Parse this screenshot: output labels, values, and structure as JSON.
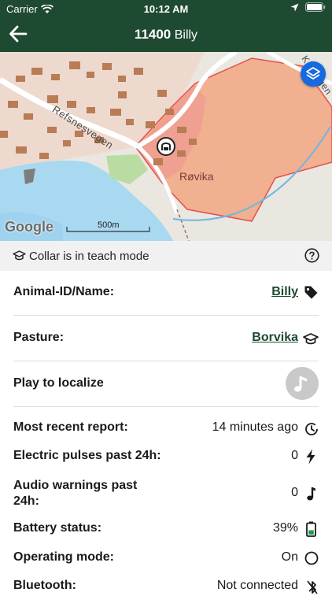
{
  "status_bar": {
    "carrier": "Carrier",
    "time": "10:12 AM"
  },
  "nav": {
    "animal_id": "11400",
    "animal_name": "Billy"
  },
  "map": {
    "labels": {
      "road": "Refsnesvegen",
      "road_ne": "Kåsvegen",
      "place": "Røvika"
    },
    "scale_label": "500m",
    "attribution": "Google",
    "pasture_color": "#f2a37c",
    "water_color": "#a9d8f1",
    "layers_button_color": "#1769e0"
  },
  "teach_banner": {
    "text": "Collar is in teach mode"
  },
  "details": {
    "animal_label": "Animal-ID/Name:",
    "animal_value": "Billy",
    "pasture_label": "Pasture:",
    "pasture_value": "Borvika",
    "play_label": "Play to localize",
    "report_label": "Most recent report:",
    "report_value": "14 minutes ago",
    "pulses_label": "Electric pulses past 24h:",
    "pulses_value": "0",
    "audio_label": "Audio warnings past 24h:",
    "audio_value": "0",
    "battery_label": "Battery status:",
    "battery_value": "39%",
    "mode_label": "Operating mode:",
    "mode_value": "On",
    "bt_label": "Bluetooth:",
    "bt_value": "Not connected"
  },
  "colors": {
    "nav": "#1f4a32",
    "link": "#1f4a32"
  }
}
